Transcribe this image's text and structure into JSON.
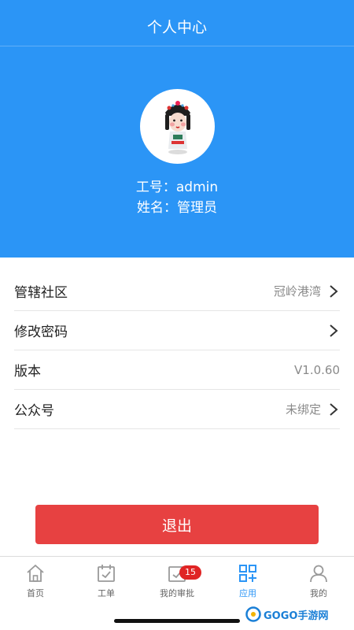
{
  "header": {
    "title": "个人中心",
    "employee_id_line": "工号：admin",
    "name_line": "姓名：管理员"
  },
  "menu": [
    {
      "label": "管辖社区",
      "value": "冠岭港湾",
      "chevron": true
    },
    {
      "label": "修改密码",
      "value": "",
      "chevron": true
    },
    {
      "label": "版本",
      "value": "V1.0.60",
      "chevron": false
    },
    {
      "label": "公众号",
      "value": "未绑定",
      "chevron": true
    }
  ],
  "logout_label": "退出",
  "tabbar": {
    "items": [
      {
        "label": "首页",
        "icon": "home-icon"
      },
      {
        "label": "工单",
        "icon": "calendar-check-icon"
      },
      {
        "label": "我的审批",
        "icon": "approval-icon",
        "badge": "15"
      },
      {
        "label": "应用",
        "icon": "apps-icon",
        "active": true
      },
      {
        "label": "我的",
        "icon": "user-icon"
      }
    ]
  },
  "colors": {
    "primary": "#2b95f6",
    "danger": "#e74141",
    "badge": "#e02424"
  },
  "watermark": "GOGO手游网"
}
